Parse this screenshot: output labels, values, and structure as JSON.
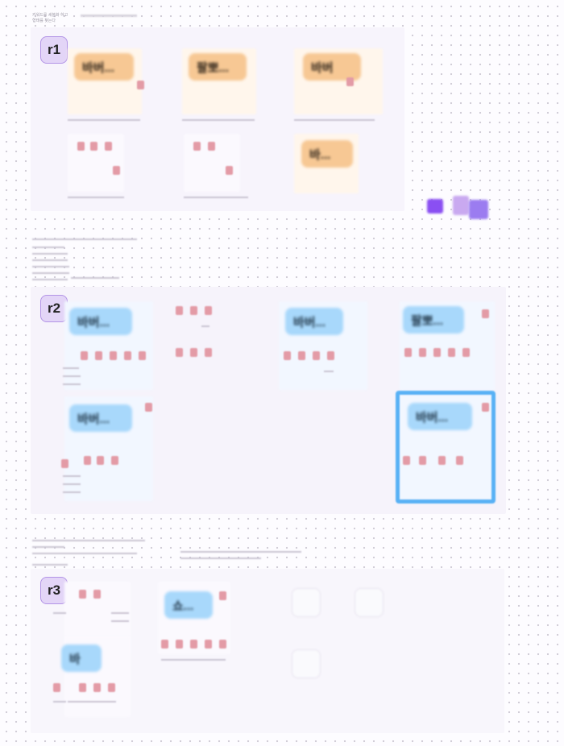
{
  "canvas": {
    "header_line1": "키워드를 세분화 하고",
    "header_line2": "형태를 찾는다"
  },
  "sections": [
    {
      "badge": "r1",
      "notes": [
        "바버...",
        "팔뽀...",
        "바버",
        "바..."
      ]
    },
    {
      "badge": "r2",
      "notes": [
        "바버...",
        "바버...",
        "팔뽀...",
        "바버...",
        "바버..."
      ]
    },
    {
      "badge": "r3",
      "notes": [
        "쇼...",
        "바"
      ]
    }
  ],
  "colors": {
    "badge_bg": "#e3d5f7",
    "note_orange": "#f7c894",
    "note_blue": "#a8d8fb",
    "highlight": "#58b1f5"
  }
}
